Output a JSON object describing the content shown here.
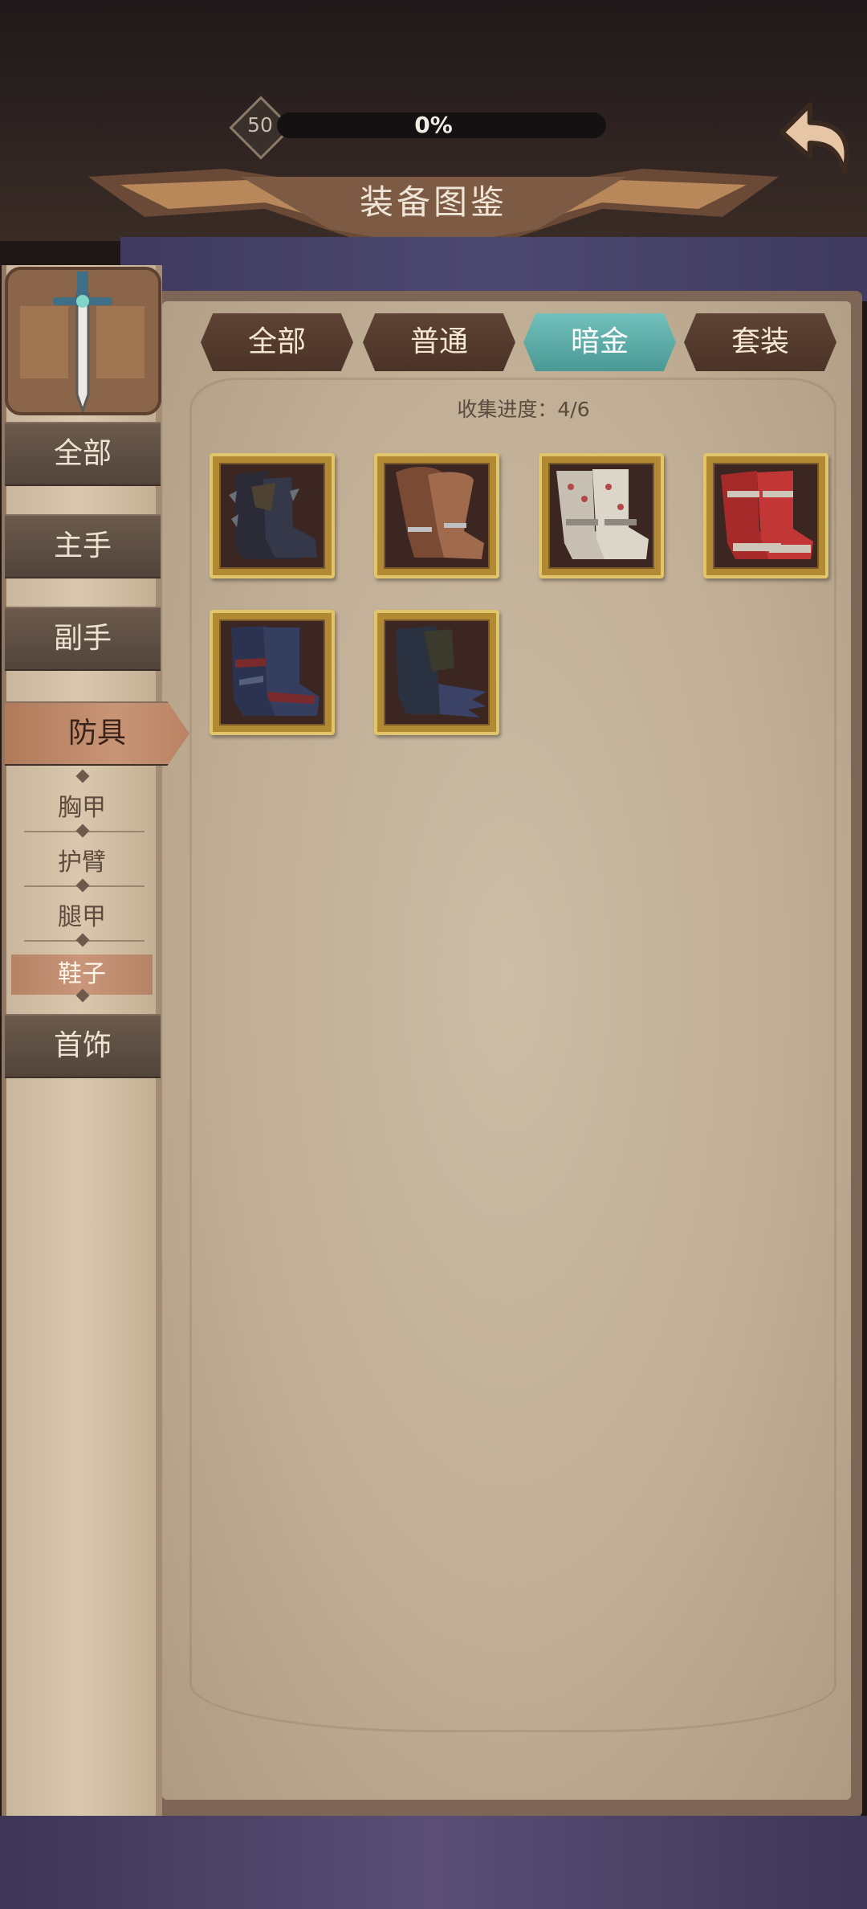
{
  "header": {
    "level": "50",
    "progress_text": "0%",
    "title": "装备图鉴"
  },
  "filter_tabs": [
    {
      "label": "全部",
      "active": false
    },
    {
      "label": "普通",
      "active": false
    },
    {
      "label": "暗金",
      "active": true
    },
    {
      "label": "套装",
      "active": false
    }
  ],
  "sidebar": {
    "categories": [
      {
        "label": "全部",
        "active": false
      },
      {
        "label": "主手",
        "active": false
      },
      {
        "label": "副手",
        "active": false
      },
      {
        "label": "防具",
        "active": true
      },
      {
        "label": "首饰",
        "active": false
      }
    ],
    "subcategories": [
      {
        "label": "胸甲",
        "active": false
      },
      {
        "label": "护臂",
        "active": false
      },
      {
        "label": "腿甲",
        "active": false
      },
      {
        "label": "鞋子",
        "active": true
      }
    ]
  },
  "collection": {
    "label": "收集进度：4/6"
  },
  "items": [
    {
      "name": "spiked-dark-boots",
      "colors": [
        "#2a2b36",
        "#4e4233"
      ]
    },
    {
      "name": "brown-leather-boots",
      "colors": [
        "#7a4a34",
        "#a06a4c"
      ]
    },
    {
      "name": "white-runed-boots",
      "colors": [
        "#c7bfb2",
        "#b34848"
      ]
    },
    {
      "name": "red-armored-boots",
      "colors": [
        "#a62a2a",
        "#cfc6ba"
      ]
    },
    {
      "name": "navy-plated-boots",
      "colors": [
        "#2c3350",
        "#7a2a2a"
      ]
    },
    {
      "name": "dark-clawed-boots",
      "colors": [
        "#2a3140",
        "#3b3a2c"
      ]
    }
  ],
  "colors": {
    "tab_active": "#4a9994",
    "tab_inactive": "#4a3327",
    "card_border": "#e1c56a",
    "panel": "#c0ae95"
  }
}
